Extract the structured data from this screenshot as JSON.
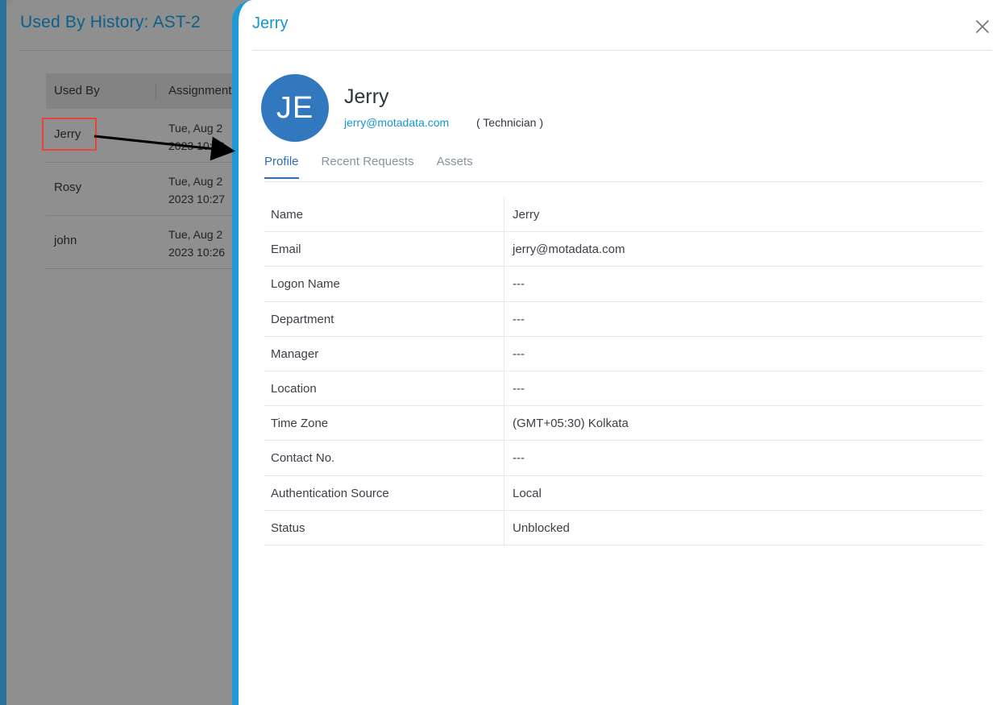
{
  "background": {
    "title": "Used By History: AST-2",
    "columns": [
      "Used By",
      "Assignment"
    ],
    "rows": [
      {
        "name": "Jerry",
        "date": "Tue, Aug 2\n2023 10:29"
      },
      {
        "name": "Rosy",
        "date": "Tue, Aug 2\n2023 10:27"
      },
      {
        "name": "john",
        "date": "Tue, Aug 2\n2023 10:26"
      }
    ]
  },
  "drawer": {
    "title": "Jerry",
    "avatar_initials": "JE",
    "user_name": "Jerry",
    "email": "jerry@motadata.com",
    "role": "( Technician )",
    "tabs": [
      {
        "label": "Profile",
        "active": true
      },
      {
        "label": "Recent Requests",
        "active": false
      },
      {
        "label": "Assets",
        "active": false
      }
    ],
    "profile": [
      {
        "label": "Name",
        "value": "Jerry"
      },
      {
        "label": "Email",
        "value": "jerry@motadata.com"
      },
      {
        "label": "Logon Name",
        "value": "---"
      },
      {
        "label": "Department",
        "value": "---"
      },
      {
        "label": "Manager",
        "value": "---"
      },
      {
        "label": "Location",
        "value": "---"
      },
      {
        "label": "Time Zone",
        "value": "(GMT+05:30) Kolkata"
      },
      {
        "label": "Contact No.",
        "value": "---"
      },
      {
        "label": "Authentication Source",
        "value": "Local"
      },
      {
        "label": "Status",
        "value": "Unblocked"
      }
    ]
  },
  "colors": {
    "accent": "#1596d1",
    "avatar": "#3178be",
    "tab_active": "#2d6fb3",
    "highlight": "#e6453c"
  },
  "icons": {
    "close": "close-icon"
  }
}
